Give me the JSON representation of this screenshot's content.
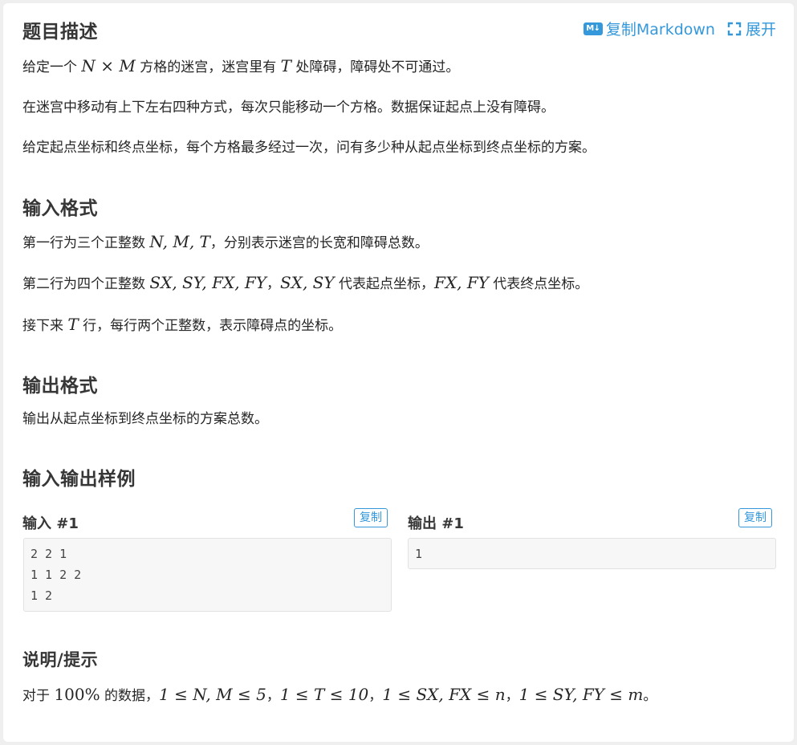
{
  "header": {
    "title": "题目描述",
    "copy_markdown_label": "复制Markdown",
    "markdown_icon_text": "M↓",
    "expand_label": "展开"
  },
  "description": {
    "p1": {
      "a": "给定一个 ",
      "b": "N × M",
      "c": " 方格的迷宫，迷宫里有 ",
      "d": "T",
      "e": " 处障碍，障碍处不可通过。"
    },
    "p2": "在迷宫中移动有上下左右四种方式，每次只能移动一个方格。数据保证起点上没有障碍。",
    "p3": "给定起点坐标和终点坐标，每个方格最多经过一次，问有多少种从起点坐标到终点坐标的方案。"
  },
  "input_format": {
    "title": "输入格式",
    "p1": {
      "a": "第一行为三个正整数 ",
      "b": "N, M, T",
      "c": "，分别表示迷宫的长宽和障碍总数。"
    },
    "p2": {
      "a": "第二行为四个正整数 ",
      "b": "SX, SY, FX, FY",
      "c": "，",
      "d": "SX, SY",
      "e": " 代表起点坐标，",
      "f": "FX, FY",
      "g": " 代表终点坐标。"
    },
    "p3": {
      "a": "接下来 ",
      "b": "T",
      "c": " 行，每行两个正整数，表示障碍点的坐标。"
    }
  },
  "output_format": {
    "title": "输出格式",
    "p1": "输出从起点坐标到终点坐标的方案总数。"
  },
  "samples": {
    "title": "输入输出样例",
    "input_title": "输入 #1",
    "output_title": "输出 #1",
    "copy_label": "复制",
    "input_text": "2 2 1\n1 1 2 2\n1 2",
    "output_text": "1"
  },
  "hint": {
    "title": "说明/提示",
    "a": "对于 ",
    "b": "100%",
    "c": " 的数据，",
    "d": "1 ≤ N, M ≤ 5",
    "e": "，",
    "f": "1 ≤ T ≤ 10",
    "g": "，",
    "h": "1 ≤ SX, FX ≤ n",
    "i": "，",
    "j": "1 ≤ SY, FY ≤ m",
    "k": "。"
  }
}
